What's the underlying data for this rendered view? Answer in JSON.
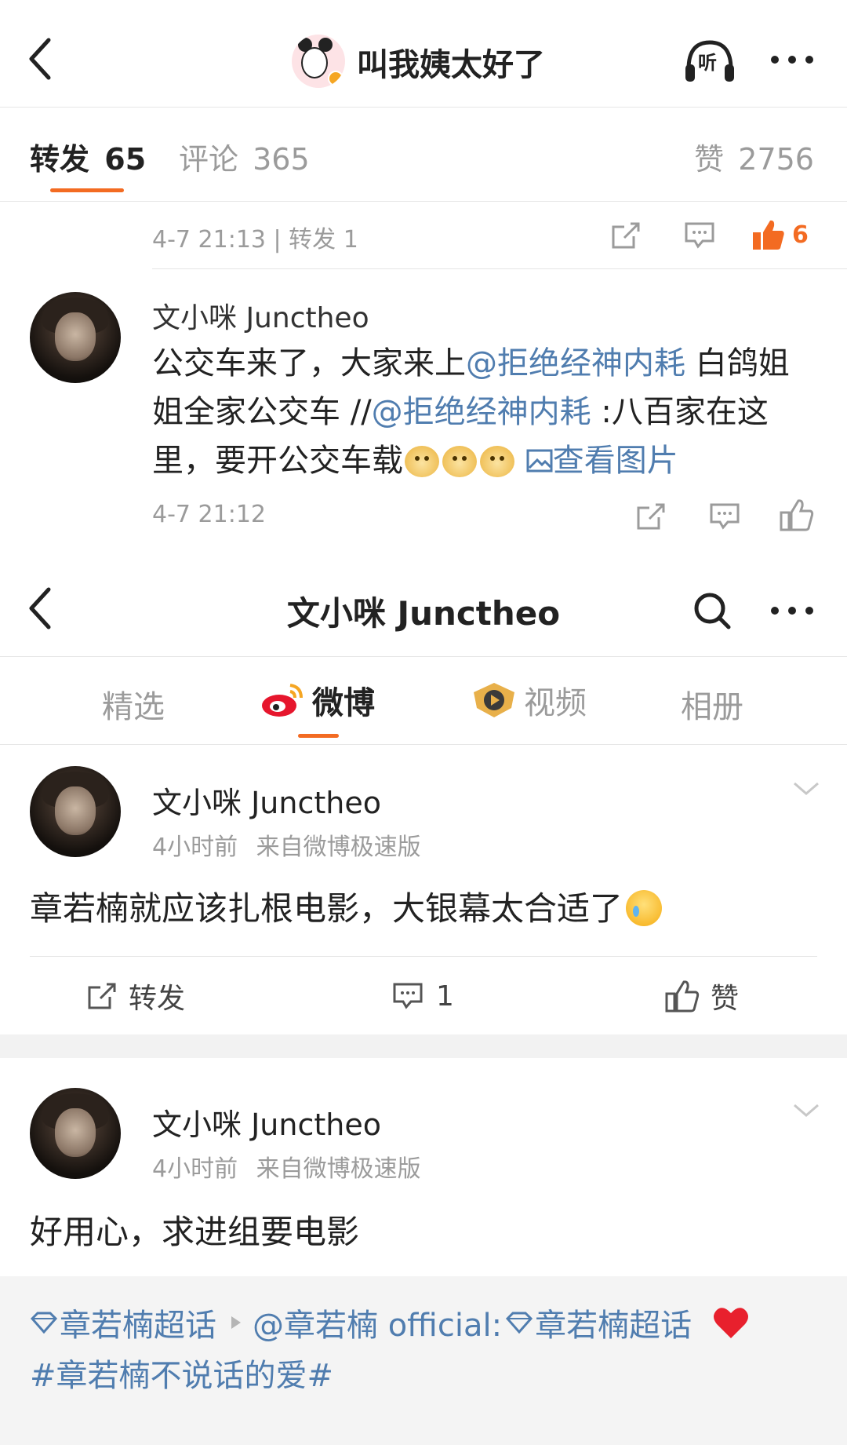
{
  "top_bar": {
    "title": "叫我姨太好了",
    "listen_label": "听"
  },
  "tabs": {
    "repost_label": "转发",
    "repost_count": "65",
    "comment_label": "评论",
    "comment_count": "365",
    "like_label": "赞",
    "like_count": "2756"
  },
  "repost_item_1": {
    "meta": "4-7 21:13 | 转发 1",
    "like_count": "6"
  },
  "repost_item_2": {
    "author": "文小咪 Junctheo",
    "text_1": "公交车来了，大家来上",
    "mention_1": "@拒绝经神内耗",
    "text_2": " 白鸽姐姐全家公交车 //",
    "mention_2": "@拒绝经神内耗",
    "text_3": " :八百家在这里，要开公交车载",
    "view_images": "查看图片",
    "time": "4-7 21:12"
  },
  "profile_bar": {
    "title": "文小咪 Junctheo"
  },
  "profile_tabs": {
    "featured": "精选",
    "weibo": "微博",
    "video": "视频",
    "album": "相册"
  },
  "post_1": {
    "author": "文小咪 Junctheo",
    "time": "4小时前",
    "source": "来自微博极速版",
    "text": "章若楠就应该扎根电影，大银幕太合适了",
    "repost_label": "转发",
    "comment_count": "1",
    "like_label": "赞"
  },
  "post_2": {
    "author": "文小咪 Junctheo",
    "time": "4小时前",
    "source": "来自微博极速版",
    "text": "好用心，求进组要电影",
    "quote_topic_1": "章若楠超话",
    "quote_mention": "@章若楠 official:",
    "quote_topic_2": "章若楠超话",
    "quote_hashtag": "#章若楠不说话的爱#"
  },
  "colors": {
    "accent_orange": "#f36b22",
    "link_blue": "#507daf",
    "text_dark": "#222222",
    "text_gray": "#9b9b9b"
  }
}
